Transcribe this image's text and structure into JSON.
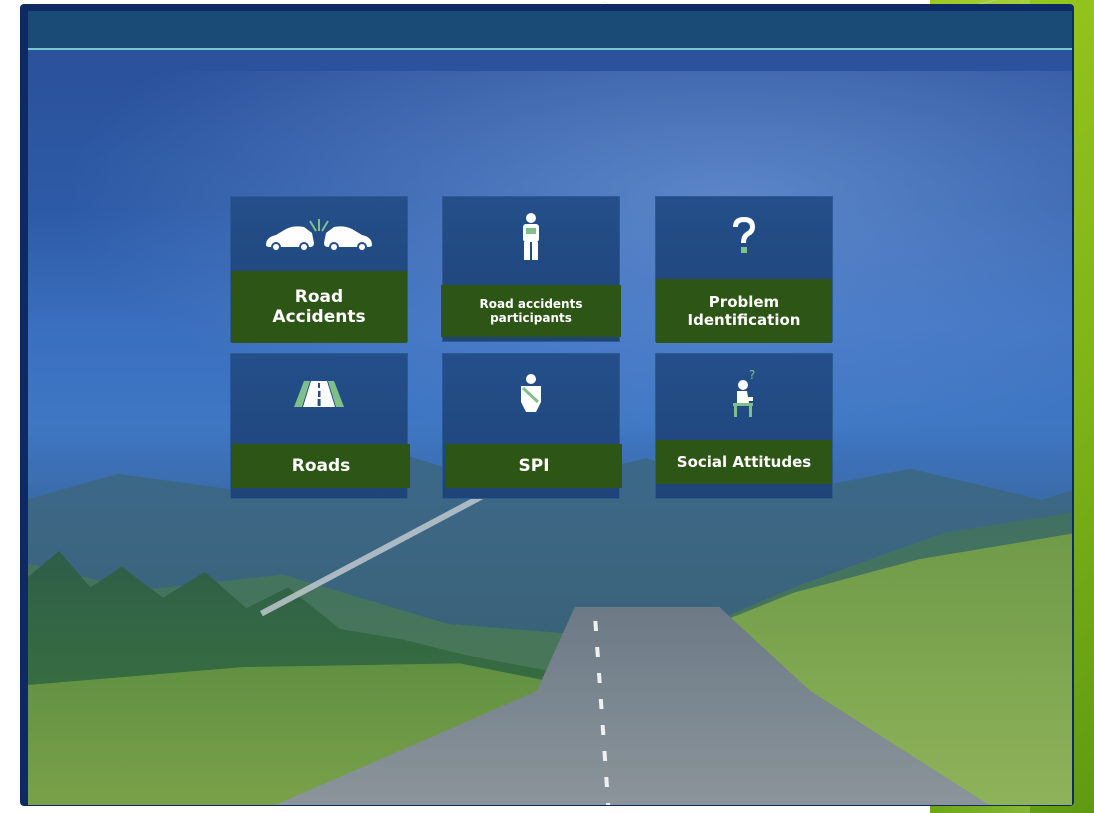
{
  "tiles": [
    {
      "id": "road-accidents",
      "label": "Road Accidents",
      "icon": "car-crash-icon"
    },
    {
      "id": "road-accidents-participants",
      "label": "Road accidents participants",
      "icon": "person-icon"
    },
    {
      "id": "problem-identification",
      "label": "Problem Identification",
      "icon": "question-mark-icon"
    },
    {
      "id": "roads",
      "label": "Roads",
      "icon": "road-icon"
    },
    {
      "id": "spi",
      "label": "SPI",
      "icon": "seatbelt-person-icon"
    },
    {
      "id": "social-attitudes",
      "label": "Social Attitudes",
      "icon": "thinking-person-icon"
    }
  ],
  "colors": {
    "frame": "#0e2a63",
    "topbar": "#1a4a76",
    "topbar_line": "#78c6cc",
    "tile": "#244f8a",
    "tile_label": "#2d5515",
    "icon": "#ffffff",
    "icon_accent": "#7fc08a",
    "side_strip": "#7fb418"
  }
}
